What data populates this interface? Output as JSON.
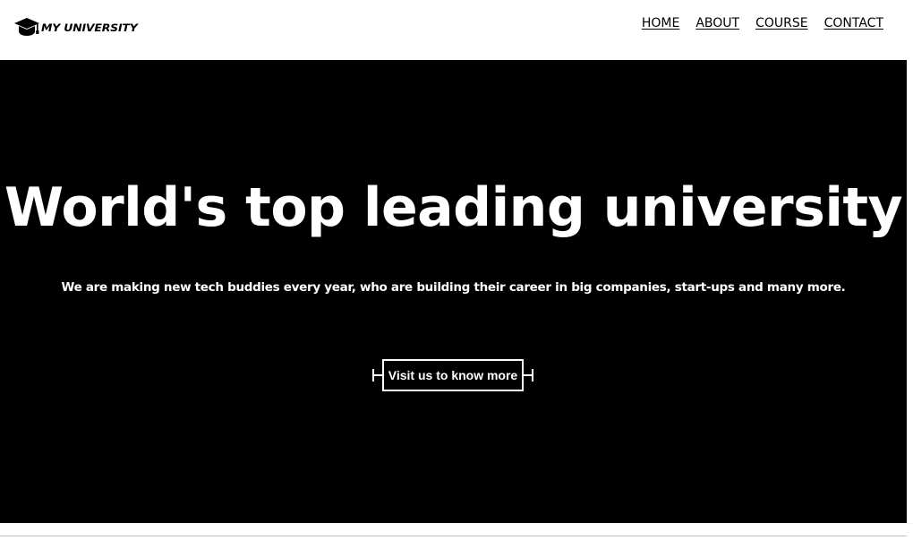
{
  "header": {
    "logo_text": "MY UNIVERSITY",
    "logo_icon": "graduation-cap-icon",
    "nav": [
      {
        "label": "HOME"
      },
      {
        "label": "ABOUT"
      },
      {
        "label": "COURSE"
      },
      {
        "label": "CONTACT"
      }
    ]
  },
  "hero": {
    "title": "World's top leading university",
    "subtitle": "We are making new tech buddies every year, who are building their career in big companies, start-ups and many more.",
    "cta_label": "Visit us to know more"
  },
  "colors": {
    "hero_background": "#000000",
    "hero_text": "#ffffff",
    "header_background": "#ffffff",
    "nav_text": "#000000"
  }
}
